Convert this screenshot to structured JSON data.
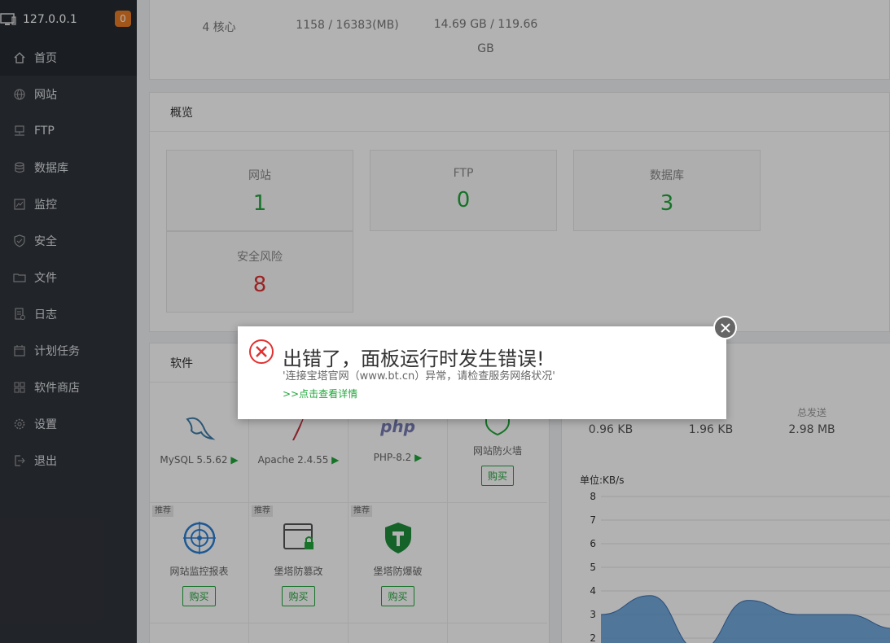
{
  "sidebar": {
    "ip": "127.0.0.1",
    "badge": "0",
    "items": [
      {
        "label": "首页",
        "icon": "home-icon"
      },
      {
        "label": "网站",
        "icon": "globe-icon"
      },
      {
        "label": "FTP",
        "icon": "ftp-icon"
      },
      {
        "label": "数据库",
        "icon": "database-icon"
      },
      {
        "label": "监控",
        "icon": "monitor-icon"
      },
      {
        "label": "安全",
        "icon": "shield-icon"
      },
      {
        "label": "文件",
        "icon": "folder-icon"
      },
      {
        "label": "日志",
        "icon": "log-icon"
      },
      {
        "label": "计划任务",
        "icon": "calendar-icon"
      },
      {
        "label": "软件商店",
        "icon": "grid-icon"
      },
      {
        "label": "设置",
        "icon": "gear-icon"
      },
      {
        "label": "退出",
        "icon": "logout-icon"
      }
    ]
  },
  "status": {
    "cpu": "4 核心",
    "mem": "1158 / 16383(MB)",
    "disk_line1": "14.69 GB / 119.66",
    "disk_line2": "GB"
  },
  "overview": {
    "title": "概览",
    "boxes": [
      {
        "label": "网站",
        "value": "1"
      },
      {
        "label": "FTP",
        "value": "0"
      },
      {
        "label": "数据库",
        "value": "3"
      },
      {
        "label": "安全风险",
        "value": "8"
      }
    ]
  },
  "software": {
    "title": "软件",
    "tag": "推荐",
    "buy": "购买",
    "row1": [
      "MySQL 5.5.62",
      "Apache 2.4.55",
      "PHP-8.2",
      "网站防火墙"
    ],
    "row2": [
      "网站监控报表",
      "堡塔防篡改",
      "堡塔防爆破"
    ],
    "php_logo": "php"
  },
  "traffic": {
    "labels": [
      "",
      "",
      "总发送"
    ],
    "values": [
      "0.96 KB",
      "1.96 KB",
      "2.98 MB"
    ],
    "unit": "单位:KB/s",
    "yticks": [
      "8",
      "7",
      "6",
      "5",
      "4",
      "3",
      "2"
    ]
  },
  "chart_data": {
    "type": "area",
    "ylabel": "单位:KB/s",
    "ylim": [
      2,
      8
    ],
    "series": [
      {
        "values": [
          3.0,
          3.8,
          1.5,
          3.6,
          3.0,
          3.0,
          2.4
        ]
      }
    ]
  },
  "dialog": {
    "title": "出错了，面板运行时发生错误!",
    "message": "'连接宝塔官网（www.bt.cn）异常，请检查服务网络状况'",
    "link": ">>点击查看详情"
  },
  "colors": {
    "accent": "#20a53a",
    "danger": "#e03131",
    "sidebar": "#30343c"
  }
}
